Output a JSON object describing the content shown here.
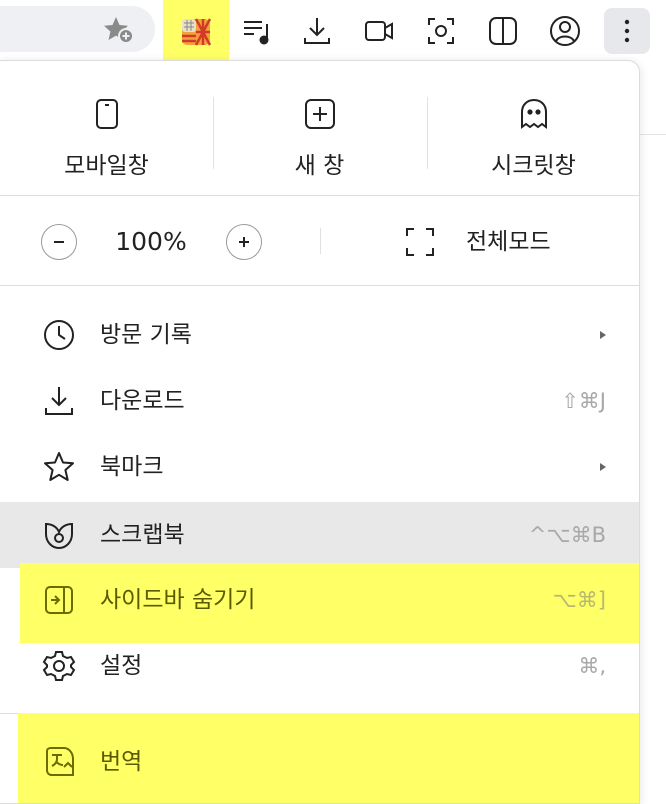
{
  "toolbar": {
    "icons": [
      "star-plus-icon",
      "puzzle-extension-icon",
      "playlist-icon",
      "download-icon",
      "video-icon",
      "screenshot-icon",
      "split-view-icon",
      "profile-icon",
      "more-menu-icon"
    ]
  },
  "menu": {
    "quick": [
      {
        "label": "모바일창",
        "icon": "mobile-window-icon"
      },
      {
        "label": "새 창",
        "icon": "new-window-icon"
      },
      {
        "label": "시크릿창",
        "icon": "secret-window-icon"
      }
    ],
    "zoom": {
      "value": "100%",
      "decrease": "−",
      "increase": "+"
    },
    "fullscreen_label": "전체모드",
    "items": [
      {
        "label": "방문 기록",
        "icon": "history-icon",
        "shortcut": "",
        "submenu": true
      },
      {
        "label": "다운로드",
        "icon": "download-icon",
        "shortcut": "⇧⌘J",
        "submenu": false
      },
      {
        "label": "북마크",
        "icon": "star-icon",
        "shortcut": "",
        "submenu": true
      },
      {
        "label": "스크랩북",
        "icon": "scrapbook-icon",
        "shortcut": "^⌥⌘B",
        "submenu": false
      },
      {
        "label": "사이드바 숨기기",
        "icon": "sidebar-icon",
        "shortcut": "⌥⌘]",
        "submenu": false
      },
      {
        "label": "설정",
        "icon": "gear-icon",
        "shortcut": "⌘,",
        "submenu": false
      },
      {
        "label": "번역",
        "icon": "translate-icon",
        "shortcut": "",
        "submenu": false
      }
    ]
  },
  "colors": {
    "highlight": "#ffff66",
    "hover": "#e8e8e8",
    "shortcut": "#a8a8a8"
  }
}
